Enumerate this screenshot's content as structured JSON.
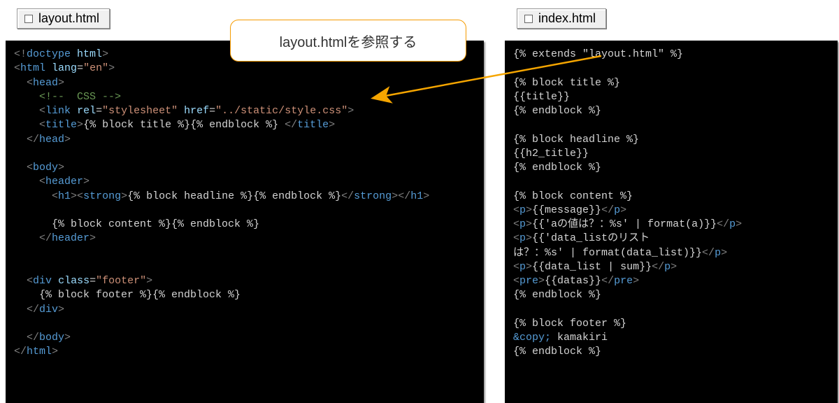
{
  "tabs": {
    "left": "layout.html",
    "right": "index.html"
  },
  "callout_text": "layout.htmlを参照する",
  "code_left_html": "<span class='punc'>&lt;!</span><span class='kw'>doctype</span> <span class='attr'>html</span><span class='punc'>&gt;</span>\n<span class='punc'>&lt;</span><span class='tag'>html</span> <span class='attr'>lang</span>=<span class='str'>\"en\"</span><span class='punc'>&gt;</span>\n  <span class='punc'>&lt;</span><span class='tag'>head</span><span class='punc'>&gt;</span>\n    <span class='cmt'>&lt;!--  CSS --&gt;</span>\n    <span class='punc'>&lt;</span><span class='tag'>link</span> <span class='attr'>rel</span>=<span class='str'>\"stylesheet\"</span> <span class='attr'>href</span>=<span class='str'>\"../static/style.css\"</span><span class='punc'>&gt;</span>\n    <span class='punc'>&lt;</span><span class='tag'>title</span><span class='punc'>&gt;</span><span class='txt'>{% block title %}{% endblock %}</span> <span class='punc'>&lt;/</span><span class='tag'>title</span><span class='punc'>&gt;</span>\n  <span class='punc'>&lt;/</span><span class='tag'>head</span><span class='punc'>&gt;</span>\n\n  <span class='punc'>&lt;</span><span class='tag'>body</span><span class='punc'>&gt;</span>\n    <span class='punc'>&lt;</span><span class='tag'>header</span><span class='punc'>&gt;</span>\n      <span class='punc'>&lt;</span><span class='tag'>h1</span><span class='punc'>&gt;&lt;</span><span class='tag'>strong</span><span class='punc'>&gt;</span><span class='txt'>{% block headline %}{% endblock %}</span><span class='punc'>&lt;/</span><span class='tag'>strong</span><span class='punc'>&gt;&lt;/</span><span class='tag'>h1</span><span class='punc'>&gt;</span>\n\n      <span class='txt'>{% block content %}{% endblock %}</span>\n    <span class='punc'>&lt;/</span><span class='tag'>header</span><span class='punc'>&gt;</span>\n\n\n  <span class='punc'>&lt;</span><span class='tag'>div</span> <span class='attr'>class</span>=<span class='str'>\"footer\"</span><span class='punc'>&gt;</span>\n    <span class='txt'>{% block footer %}{% endblock %}</span>\n  <span class='punc'>&lt;/</span><span class='tag'>div</span><span class='punc'>&gt;</span>\n\n  <span class='punc'>&lt;/</span><span class='tag'>body</span><span class='punc'>&gt;</span>\n<span class='punc'>&lt;/</span><span class='tag'>html</span><span class='punc'>&gt;</span>",
  "code_right_html": "<span class='txt'>{% extends &quot;layout.html&quot; %}</span>\n\n<span class='txt'>{% block title %}</span>\n<span class='txt'>{{title}}</span>\n<span class='txt'>{% endblock %}</span>\n\n<span class='txt'>{% block headline %}</span>\n<span class='txt'>{{h2_title}}</span>\n<span class='txt'>{% endblock %}</span>\n\n<span class='txt'>{% block content %}</span>\n<span class='punc'>&lt;</span><span class='tag'>p</span><span class='punc'>&gt;</span><span class='txt'>{{message}}</span><span class='punc'>&lt;/</span><span class='tag'>p</span><span class='punc'>&gt;</span>\n<span class='punc'>&lt;</span><span class='tag'>p</span><span class='punc'>&gt;</span><span class='txt'>{{'aの値は？：%s' | format(a)}}</span><span class='punc'>&lt;/</span><span class='tag'>p</span><span class='punc'>&gt;</span>\n<span class='punc'>&lt;</span><span class='tag'>p</span><span class='punc'>&gt;</span><span class='txt'>{{'data_listのリスト</span>\n<span class='txt'>は？：%s' | format(data_list)}}</span><span class='punc'>&lt;/</span><span class='tag'>p</span><span class='punc'>&gt;</span>\n<span class='punc'>&lt;</span><span class='tag'>p</span><span class='punc'>&gt;</span><span class='txt'>{{data_list | sum}}</span><span class='punc'>&lt;/</span><span class='tag'>p</span><span class='punc'>&gt;</span>\n<span class='punc'>&lt;</span><span class='tag'>pre</span><span class='punc'>&gt;</span><span class='txt'>{{datas}}</span><span class='punc'>&lt;/</span><span class='tag'>pre</span><span class='punc'>&gt;</span>\n<span class='txt'>{% endblock %}</span>\n\n<span class='txt'>{% block footer %}</span>\n<span class='kw'>&amp;copy;</span><span class='txt'> kamakiri</span>\n<span class='txt'>{% endblock %}</span>"
}
